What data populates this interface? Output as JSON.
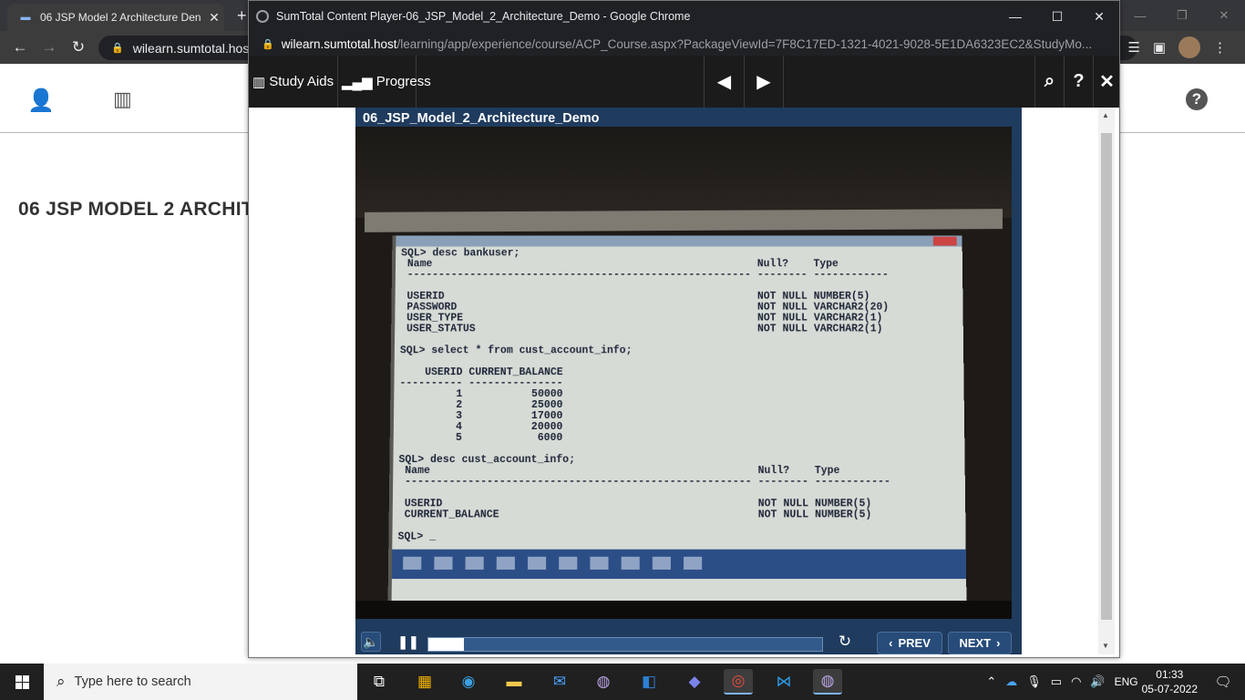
{
  "background_browser": {
    "tab_title": "06 JSP Model 2 Architecture Den",
    "url_host": "wilearn.sumtotal.host",
    "page_heading": "06 JSP MODEL 2 ARCHIT"
  },
  "popup": {
    "window_title": "SumTotal Content Player-06_JSP_Model_2_Architecture_Demo - Google Chrome",
    "url_host": "wilearn.sumtotal.host",
    "url_path": "/learning/app/experience/course/ACP_Course.aspx?PackageViewId=7F8C17ED-1321-4021-9028-5E1DA6323EC2&StudyMo...",
    "toolbar": {
      "study_aids": "Study Aids",
      "progress": "Progress"
    },
    "video": {
      "title": "06_JSP_Model_2_Architecture_Demo",
      "screen_text": "SQL> desc bankuser;\n Name                                                    Null?    Type\n ------------------------------------------------------- -------- ------------\n\n USERID                                                  NOT NULL NUMBER(5)\n PASSWORD                                                NOT NULL VARCHAR2(20)\n USER_TYPE                                               NOT NULL VARCHAR2(1)\n USER_STATUS                                             NOT NULL VARCHAR2(1)\n\nSQL> select * from cust_account_info;\n\n    USERID CURRENT_BALANCE\n---------- ---------------\n         1           50000\n         2           25000\n         3           17000\n         4           20000\n         5            6000\n\nSQL> desc cust_account_info;\n Name                                                    Null?    Type\n ------------------------------------------------------- -------- ------------\n\n USERID                                                  NOT NULL NUMBER(5)\n CURRENT_BALANCE                                         NOT NULL NUMBER(5)\n\nSQL> _",
      "progress_fraction": 0.09
    },
    "controls": {
      "prev_label": "PREV",
      "next_label": "NEXT"
    }
  },
  "taskbar": {
    "search_placeholder": "Type here to search",
    "language": "ENG",
    "time": "01:33",
    "date": "05-07-2022"
  }
}
